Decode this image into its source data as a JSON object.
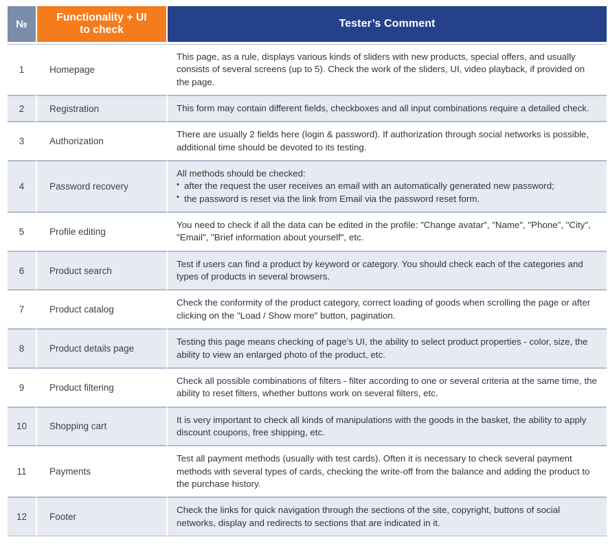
{
  "table": {
    "headers": {
      "no": "№",
      "functionality": "Functionality + UI to check",
      "functionality_line1": "Functionality + UI",
      "functionality_line2": "to check",
      "comment": "Tester’s Comment"
    },
    "colors": {
      "header_no_bg": "#7b8da8",
      "header_func_bg": "#f47c1c",
      "header_comment_bg": "#25418a",
      "row_even_bg": "#e7ebf1",
      "row_odd_bg": "#ffffff",
      "row_border": "#aebacd",
      "text": "#3b4149"
    },
    "rows": [
      {
        "no": "1",
        "functionality": "Homepage",
        "comment": "This page, as a rule, displays various kinds of sliders with new products, special offers, and usually consists of several screens (up to 5). Check the work of the sliders, UI, video playback, if provided on the page."
      },
      {
        "no": "2",
        "functionality": "Registration",
        "comment": "This form may contain different fields, checkboxes and all input combinations require a detailed check."
      },
      {
        "no": "3",
        "functionality": "Authorization",
        "comment": "There are usually 2 fields here (login & password). If authorization through social networks is possible, additional time should be devoted to its testing."
      },
      {
        "no": "4",
        "functionality": "Password recovery",
        "comment_lead": "All methods should be checked:",
        "comment_bullets": [
          "after the request the user receives an email with an automatically generated new password;",
          "the password is reset via the link from Email via the password reset form."
        ]
      },
      {
        "no": "5",
        "functionality": "Profile editing",
        "comment": "You need to check if all the data can be edited in the profile: \"Change avatar\", \"Name\", \"Phone\", \"City\", \"Email\", \"Brief information about yourself\", etc."
      },
      {
        "no": "6",
        "functionality": "Product search",
        "comment": "Test if users can find a product by keyword or category. You should check each of the categories and types of products in several browsers."
      },
      {
        "no": "7",
        "functionality": "Product catalog",
        "comment": "Check the conformity of the product category, correct loading of goods when scrolling the page or after clicking on the \"Load / Show more\" button, pagination."
      },
      {
        "no": "8",
        "functionality": "Product details page",
        "comment": "Testing this page means checking of page’s UI, the ability to select product properties - color, size, the ability to view an enlarged photo of the product, etc."
      },
      {
        "no": "9",
        "functionality": "Product filtering",
        "comment": "Check all possible combinations of filters - filter according to one or several criteria at the same time, the ability to reset filters, whether buttons work on several filters, etc."
      },
      {
        "no": "10",
        "functionality": "Shopping cart",
        "comment": "It is very important to check all kinds of manipulations with the goods in the basket, the ability to apply discount coupons, free shipping, etc."
      },
      {
        "no": "11",
        "functionality": "Payments",
        "comment": "Test all payment methods (usually with test cards). Often it is necessary to check several payment methods with several types of cards, checking the write-off from the balance and adding the product to the purchase history."
      },
      {
        "no": "12",
        "functionality": "Footer",
        "comment": "Check the links for quick navigation through the sections of the site, copyright, buttons of social networks, display and redirects to sections that are indicated in it."
      }
    ]
  }
}
